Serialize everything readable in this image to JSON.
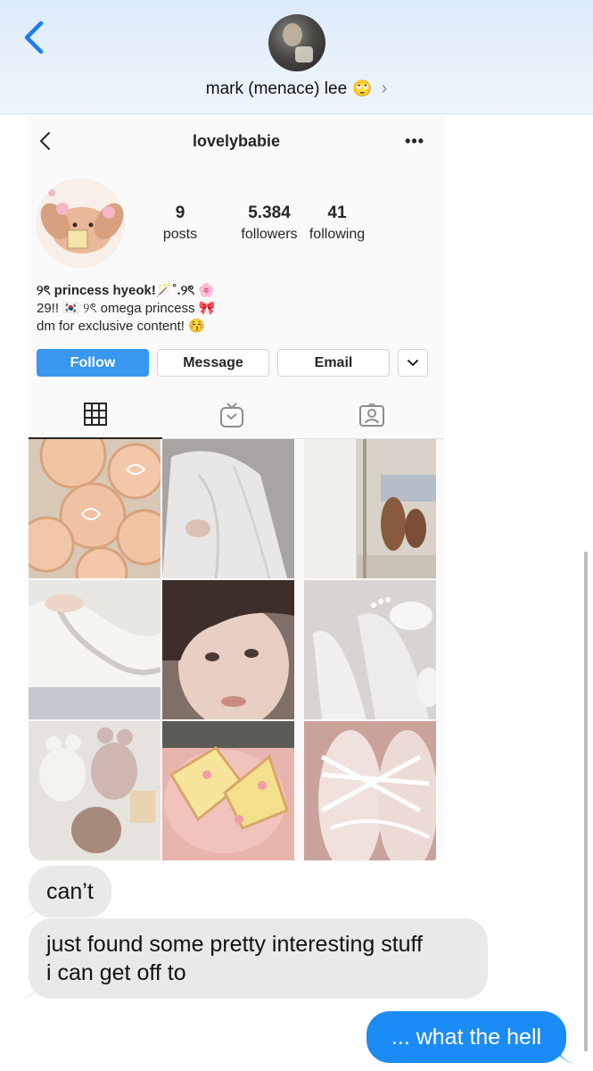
{
  "header": {
    "contact_name": "mark (menace) lee",
    "contact_emoji": "🙄",
    "chevron": "›",
    "back_icon": "chevron-left-icon",
    "accent_color": "#1b7cf2"
  },
  "instagram": {
    "username": "lovelybabie",
    "more_label": "•••",
    "stats": [
      {
        "value": "9",
        "label": "posts"
      },
      {
        "value": "5.384",
        "label": "followers"
      },
      {
        "value": "41",
        "label": "following"
      }
    ],
    "bio": {
      "line1": "୨ৎ princess hyeok!🪄˚.୨ৎ 🌸",
      "line2": "29!! 🇰🇷 ୨ৎ omega princess 🎀",
      "line3": "dm for exclusive content! 😚"
    },
    "buttons": {
      "follow": "Follow",
      "message": "Message",
      "email": "Email"
    },
    "tabs": [
      "grid-icon",
      "igtv-icon",
      "tagged-icon"
    ],
    "grid_posts": [
      "heart cookies",
      "white shirt",
      "mirror photo",
      "white slip",
      "selfie",
      "lace stockings",
      "plush toys",
      "cake slices",
      "ribbon shoes"
    ]
  },
  "messages": [
    {
      "direction": "in",
      "text": "can’t"
    },
    {
      "direction": "in",
      "text_line1": "just found some pretty interesting stuff",
      "text_line2": "i can get off to"
    },
    {
      "direction": "out",
      "text": "... what the hell"
    }
  ],
  "colors": {
    "incoming_bubble": "#e9e9eb",
    "outgoing_bubble": "#1b8cf5",
    "follow_button": "#3897f0"
  }
}
